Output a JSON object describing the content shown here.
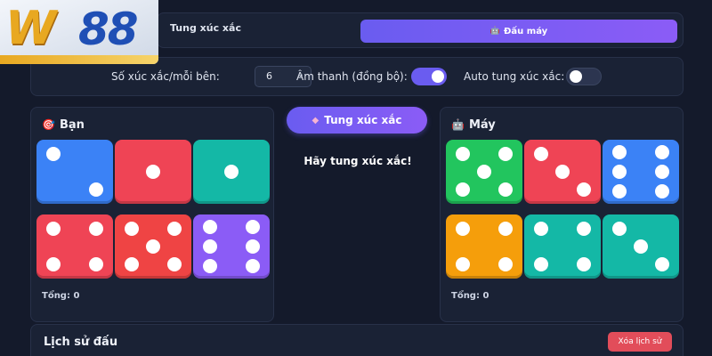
{
  "logo": {
    "letter": "W",
    "number": "88"
  },
  "mode_tabs": [
    {
      "label": "Tung xúc xắc",
      "active": false
    },
    {
      "icon": "robot-icon",
      "label": "Đấu máy",
      "active": true
    }
  ],
  "settings": {
    "dice_count_label": "Số xúc xắc/mỗi bên:",
    "dice_count_value": "6",
    "sound_label": "Âm thanh (đồng bộ):",
    "sound_on": true,
    "auto_roll_label": "Auto tung xúc xắc:",
    "auto_roll_on": false
  },
  "player": {
    "icon": "target-icon",
    "title": "Bạn",
    "total": "Tổng: 0",
    "dice": [
      {
        "value": 2,
        "color": "#3b82f6"
      },
      {
        "value": 1,
        "color": "#ef4455"
      },
      {
        "value": 1,
        "color": "#14b8a6"
      },
      {
        "value": 4,
        "color": "#ef4455"
      },
      {
        "value": 5,
        "color": "#ef4444"
      },
      {
        "value": 6,
        "color": "#8b5cf6"
      }
    ]
  },
  "computer": {
    "icon": "robot-icon",
    "title": "Máy",
    "total": "Tổng: 0",
    "dice": [
      {
        "value": 5,
        "color": "#22c55e"
      },
      {
        "value": 3,
        "color": "#ef4455"
      },
      {
        "value": 6,
        "color": "#3b82f6"
      },
      {
        "value": 4,
        "color": "#f59e0b"
      },
      {
        "value": 4,
        "color": "#14b8a6"
      },
      {
        "value": 3,
        "color": "#14b8a6"
      }
    ]
  },
  "roll_button": {
    "icon": "gem-icon",
    "label": "Tung xúc xắc"
  },
  "prompt": "Hãy tung xúc xắc!",
  "history": {
    "title": "Lịch sử đấu",
    "clear_label": "Xóa lịch sử"
  },
  "colors": {
    "accent": "#6a5cf0",
    "background": "#141a2b",
    "panel": "#1a2235",
    "danger": "#e24d5a"
  }
}
